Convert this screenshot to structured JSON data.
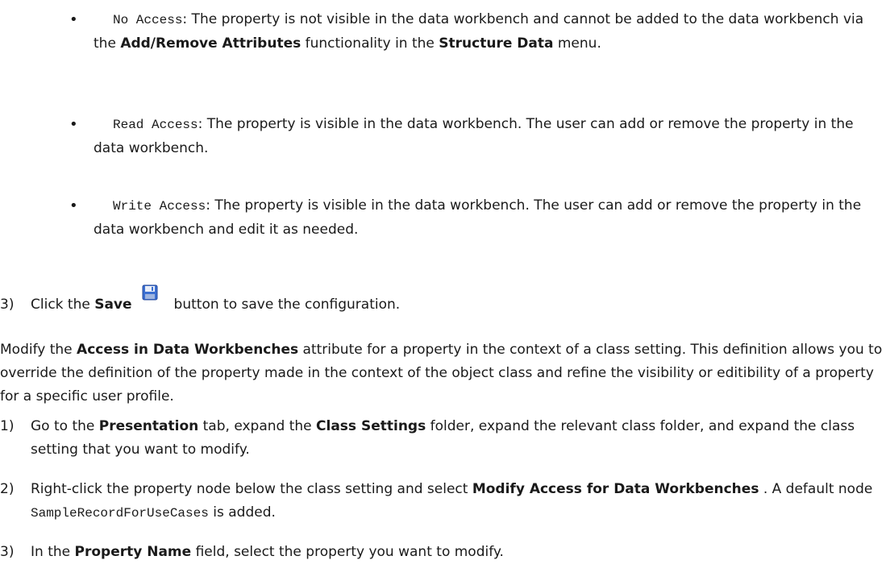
{
  "bullets": [
    {
      "code": "No Access",
      "t1": ": The property is not visible in the data workbench and cannot be added to the data workbench via the ",
      "b1": "Add/Remove Attributes",
      "t2": " functionality in the ",
      "b2": "Structure Data",
      "t3": " menu."
    },
    {
      "code": "Read Access",
      "t1": ": The property is visible in the data workbench. The user can add or remove the property in the data workbench."
    },
    {
      "code": "Write Access",
      "t1": ": The property is visible in the data workbench. The user can add or remove the property in the data workbench and edit it as needed."
    }
  ],
  "save_step": {
    "num": "3)",
    "pre": "Click the ",
    "bold": "Save",
    "post": "button to save the configuration.",
    "icon": "floppy-disk-icon"
  },
  "intro": {
    "pre": "Modify the ",
    "bold": "Access in Data Workbenches",
    "post": " attribute for a property in the context of a class setting. This definition allows you to override the definition of the property made in the context of the object class and refine the visibility or editibility of a property for a specific user profile."
  },
  "steps": [
    {
      "num": "1)",
      "pre": "Go to the ",
      "b1": "Presentation",
      "mid": " tab, expand the ",
      "b2": "Class Settings",
      "post": " folder, expand the relevant class folder, and expand the class setting that you want to modify."
    },
    {
      "num": "2)",
      "pre": "Right-click the property node below the class setting and select ",
      "b1": "Modify Access for Data Workbenches",
      "mid": " . A default node ",
      "code": "SampleRecordForUseCases",
      "post": " is added."
    },
    {
      "num": "3)",
      "pre": "In the ",
      "b1": "Property Name",
      "post": " field, select the property you want to modify."
    }
  ]
}
